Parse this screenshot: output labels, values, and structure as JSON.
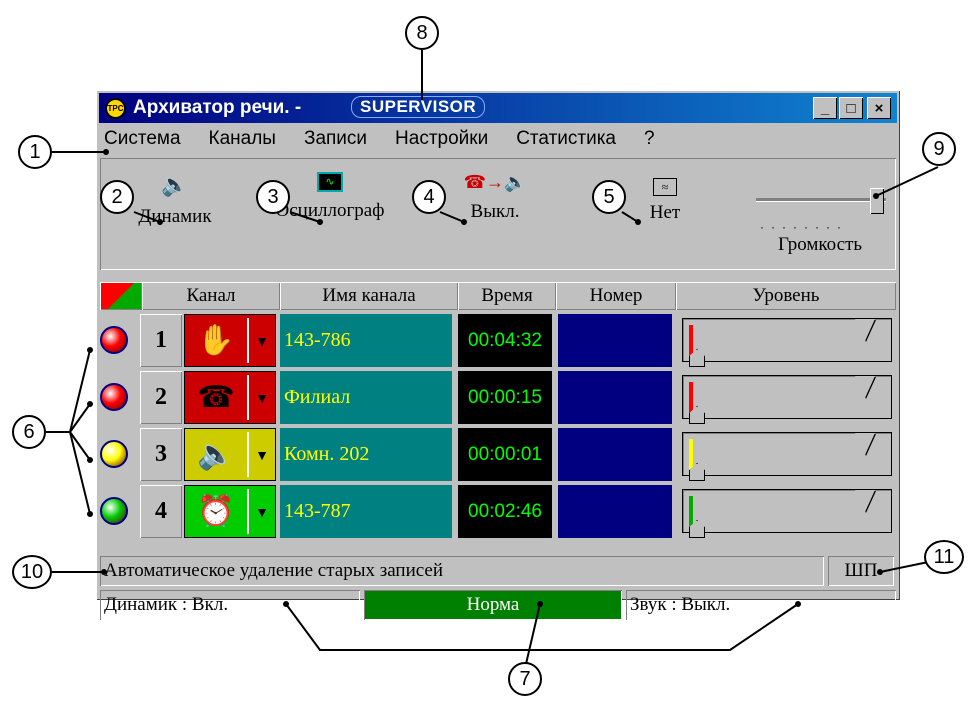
{
  "window": {
    "title": "Архиватор речи. -",
    "brand": "SUPERVISOR",
    "min_label": "_",
    "max_label": "□",
    "close_label": "×"
  },
  "menu": [
    "Система",
    "Каналы",
    "Записи",
    "Настройки",
    "Статистика",
    "?"
  ],
  "toolbar": {
    "speaker_label": "Динамик",
    "oscilloscope_label": "Осциллограф",
    "mode_label": "Выкл.",
    "filter_label": "Нет",
    "volume_label": "Громкость",
    "volume_level": 1.0
  },
  "grid": {
    "headers": [
      "Канал",
      "Имя канала",
      "Время",
      "Номер",
      "Уровень"
    ],
    "rows": [
      {
        "number": "1",
        "name": "143-786",
        "time": "00:04:32",
        "icon": "hand-icon",
        "type_color": "#cc0000",
        "led": "#ff0000",
        "level": 0.01,
        "level_color": "#ff0000"
      },
      {
        "number": "2",
        "name": "Филиал",
        "time": "00:00:15",
        "icon": "phone-icon",
        "type_color": "#cc0000",
        "led": "#ff0000",
        "level": 0.01,
        "level_color": "#ff0000"
      },
      {
        "number": "3",
        "name": "Комн. 202",
        "time": "00:00:01",
        "icon": "speaker-icon",
        "type_color": "#cccc00",
        "led": "#ffff00",
        "level": 0.02,
        "level_color": "#ffff00"
      },
      {
        "number": "4",
        "name": "143-787",
        "time": "00:02:46",
        "icon": "alarm-clock-icon",
        "type_color": "#00cc00",
        "led": "#00cc00",
        "level": 0.01,
        "level_color": "#00aa00"
      }
    ]
  },
  "status": {
    "message": "Автоматическое удаление старых записей",
    "mode": "ШП",
    "speaker": "Динамик : Вкл.",
    "state": "Норма",
    "state_color": "#008000",
    "sound": "Звук : Выкл."
  },
  "callouts": [
    "1",
    "2",
    "3",
    "4",
    "5",
    "6",
    "7",
    "8",
    "9",
    "10",
    "11"
  ]
}
